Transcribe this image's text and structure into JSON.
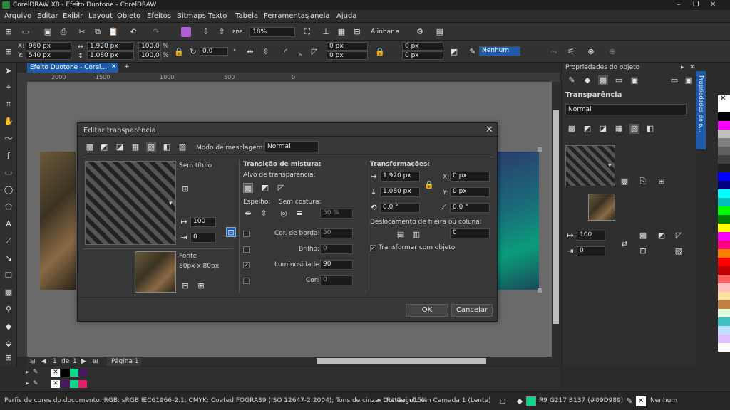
{
  "window": {
    "title": "CorelDRAW X8 - Efeito Duotone - CorelDRAW"
  },
  "menu": [
    "Arquivo",
    "Editar",
    "Exibir",
    "Layout",
    "Objeto",
    "Efeitos",
    "Bitmaps",
    "Texto",
    "Tabela",
    "Ferramentas",
    "Janela",
    "Ajuda"
  ],
  "toolbar": {
    "zoom": "18%",
    "align_label": "Alinhar a"
  },
  "propbar": {
    "x": "960 px",
    "y": "540 px",
    "x_label": "X:",
    "y_label": "Y:",
    "w": "1.920 px",
    "h": "1.080 px",
    "scale_w": "100,0",
    "scale_h": "100,0",
    "pct": "%",
    "angle": "0,0",
    "corner1": "0 px",
    "corner2": "0 px",
    "corner3": "0 px",
    "corner4": "0 px",
    "outline": "Nenhum"
  },
  "doctab": {
    "name": "Efeito Duotone - Corel..."
  },
  "ruler": {
    "ticks": [
      "2000",
      "1500",
      "1000",
      "500",
      "0"
    ],
    "unit": "pixels"
  },
  "dialog": {
    "title": "Editar transparência",
    "blend_mode_label": "Modo de mesclagem:",
    "blend_mode_value": "Normal",
    "pattern_name": "Sem título",
    "w_value": "100",
    "h_value": "0",
    "source_label": "Fonte",
    "source_size": "80px x 80px",
    "mix_title": "Transição de mistura:",
    "target_label": "Alvo de transparência:",
    "mirror_label": "Espelho:",
    "seamless_label": "Sem costura:",
    "seamless_value": "50 %",
    "edge_color_label": "Cor. de borda:",
    "edge_color_value": "50",
    "brightness_label": "Brilho:",
    "brightness_value": "0",
    "luminosity_label": "Luminosidade:",
    "luminosity_value": "90",
    "color_label": "Cor:",
    "color_value": "0",
    "transform_title": "Transformações:",
    "t_w": "1.920 px",
    "t_h": "1.080 px",
    "t_x": "0 px",
    "t_y": "0 px",
    "t_x_label": "X:",
    "t_y_label": "Y:",
    "t_rot": "0,0 °",
    "t_skew": "0,0 °",
    "row_offset_label": "Deslocamento de fileira ou coluna:",
    "row_offset_value": "0",
    "transform_with_object": "Transformar com objeto",
    "ok": "OK",
    "cancel": "Cancelar"
  },
  "rightpanel": {
    "title": "Propriedades do objeto",
    "section": "Transparência",
    "mode": "Normal",
    "w_value": "100",
    "h_value": "0",
    "side_tab": "Propriedades do o..."
  },
  "pagenav": {
    "current": "1",
    "of": "de",
    "total": "1",
    "page_tab": "Página 1"
  },
  "statusbar": {
    "color_profile": "Perfis de cores do documento: RGB: sRGB IEC61966-2.1; CMYK: Coated FOGRA39 (ISO 12647-2:2004); Tons de cinza: Dot Gain 15%",
    "object_info": "Retângulo em Camada 1  (Lente)",
    "fill_info": "R9 G217 B137 (#09D989)",
    "outline_info": "Nenhum"
  },
  "colors": {
    "accent": "#09d989",
    "highlight": "#1e5aa8"
  },
  "palette": [
    "#ffffff",
    "#000000",
    "#ff00ff",
    "#c0c0c0",
    "#808080",
    "#00ffff",
    "#8080ff",
    "#0000ff",
    "#000080",
    "#008000",
    "#00ff00",
    "#ffff00",
    "#ff8000",
    "#ff0000",
    "#800000",
    "#ff0080",
    "#ff4040",
    "#ffc0c0",
    "#c08040",
    "#804000",
    "#ffe080",
    "#e0ffe0",
    "#40c0c0",
    "#c0e0ff",
    "#e0c0ff",
    "#ffffff",
    "#000000",
    "#606060",
    "#a0a0a0",
    "#ffffff",
    "#202020"
  ]
}
